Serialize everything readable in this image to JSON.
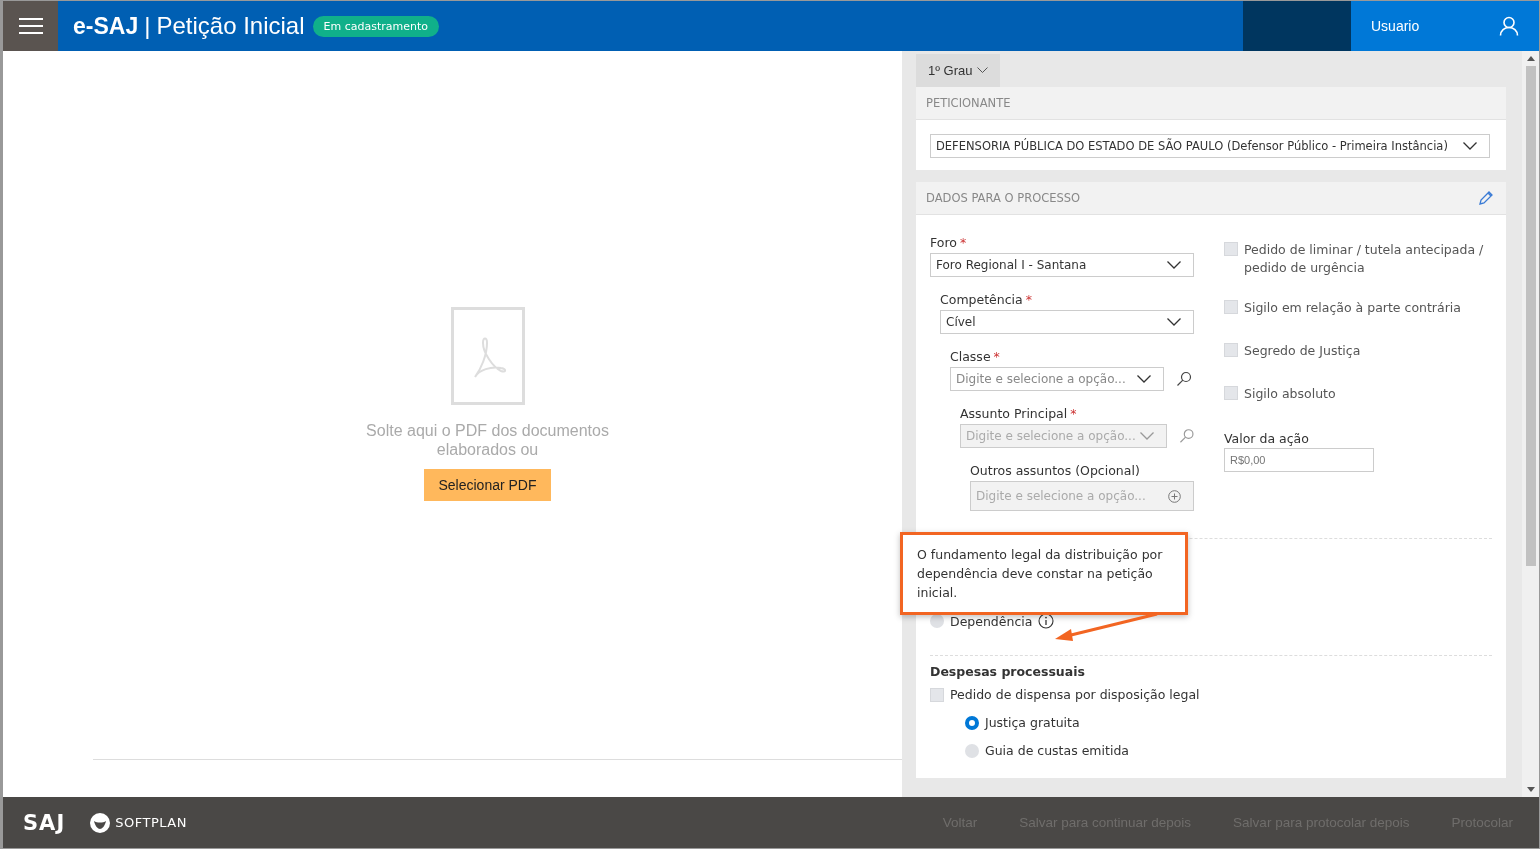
{
  "header": {
    "brand": "e-SAJ",
    "separator": "|",
    "title": "Petição Inicial",
    "status_badge": "Em cadastramento",
    "user": "Usuario"
  },
  "drop_zone": {
    "message": "Solte aqui o PDF dos documentos elaborados ou",
    "button": "Selecionar PDF"
  },
  "instance_tab": {
    "label": "1º Grau",
    "selected": true
  },
  "peticionante": {
    "heading": "PETICIONANTE",
    "value": "DEFENSORIA PÚBLICA DO ESTADO DE SÃO PAULO (Defensor Público - Primeira Instância)"
  },
  "dados": {
    "heading": "DADOS PARA O PROCESSO",
    "fields": [
      {
        "label": "Foro",
        "mark": "*",
        "kind": "select",
        "value": "Foro Regional I - Santana",
        "disabled": false
      },
      {
        "label": "Competência",
        "mark": "*",
        "kind": "select",
        "value": "Cível",
        "disabled": false
      },
      {
        "label": "Classe",
        "mark": "*",
        "kind": "search",
        "placeholder": "Digite e selecione a opção...",
        "disabled": false
      },
      {
        "label": "Assunto Principal",
        "mark": "*",
        "kind": "search",
        "placeholder": "Digite e selecione a opção...",
        "disabled": true
      },
      {
        "label": "Outros assuntos (Opcional)",
        "kind": "add",
        "placeholder": "Digite e selecione a opção...",
        "disabled": true
      }
    ],
    "options": [
      {
        "label": "Pedido de liminar / tutela antecipada / pedido de urgência",
        "checked": false
      },
      {
        "label": "Sigilo em relação à parte contrária",
        "checked": false
      },
      {
        "label": "Segredo de Justiça",
        "checked": false
      },
      {
        "label": "Sigilo absoluto",
        "checked": false
      }
    ],
    "valor": {
      "label": "Valor da ação",
      "placeholder": "R$0,00"
    },
    "dependencia": {
      "label": "Dependência",
      "selected": false
    },
    "despesas": {
      "heading": "Despesas processuais",
      "dispensa": {
        "label": "Pedido de dispensa por disposição legal",
        "checked": false
      },
      "choices": [
        {
          "label": "Justiça gratuita",
          "selected": true
        },
        {
          "label": "Guia de custas emitida",
          "selected": false
        }
      ]
    }
  },
  "callout": {
    "text": "O fundamento legal da distribuição por dependência deve constar na petição inicial."
  },
  "footer": {
    "logo": "SAJ",
    "brand": "SOFTPLAN",
    "actions": [
      {
        "label": "Voltar",
        "disabled": true
      },
      {
        "label": "Salvar para continuar depois",
        "disabled": true
      },
      {
        "label": "Salvar para protocolar depois",
        "disabled": true
      },
      {
        "label": "Protocolar",
        "disabled": true
      }
    ]
  }
}
